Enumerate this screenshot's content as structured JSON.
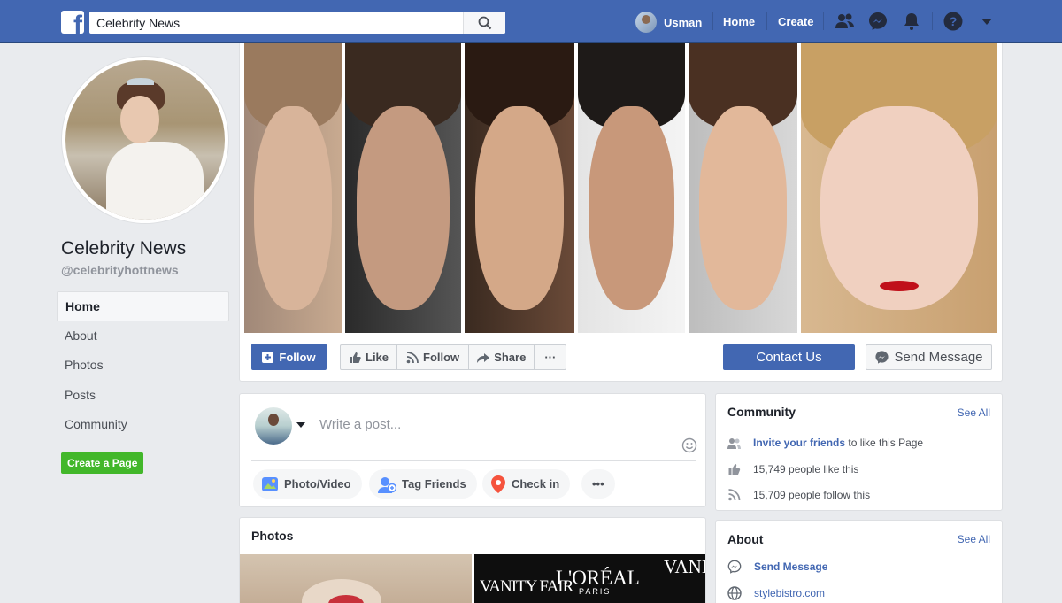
{
  "topbar": {
    "logo_letter": "f",
    "search_value": "Celebrity News",
    "user_name": "Usman",
    "nav": [
      "Home",
      "Create"
    ]
  },
  "profile": {
    "page_name": "Celebrity News",
    "handle": "@celebrityhottnews"
  },
  "left_nav": [
    {
      "label": "Home",
      "active": true
    },
    {
      "label": "About"
    },
    {
      "label": "Photos"
    },
    {
      "label": "Posts"
    },
    {
      "label": "Community"
    }
  ],
  "create_page": "Create a Page",
  "actions": {
    "follow_primary": "Follow",
    "like": "Like",
    "follow": "Follow",
    "share": "Share",
    "more": "···",
    "contact": "Contact Us",
    "send_message": "Send Message"
  },
  "composer": {
    "placeholder": "Write a post...",
    "photo_video": "Photo/Video",
    "tag_friends": "Tag Friends",
    "check_in": "Check in",
    "more": "•••"
  },
  "community": {
    "title": "Community",
    "see_all": "See All",
    "invite_link": "Invite your friends",
    "invite_rest": "to like this Page",
    "likes": "15,749 people like this",
    "follows": "15,709 people follow this"
  },
  "photos": {
    "title": "Photos",
    "photo2_caption_1": "VANITY FAIR",
    "photo2_caption_2": "L'ORÉAL",
    "photo2_caption_3": "PARIS",
    "photo2_caption_4": "VANIT"
  },
  "about": {
    "title": "About",
    "see_all": "See All",
    "send_message": "Send Message",
    "website": "stylebistro.com"
  },
  "colors": {
    "brand": "#4267b2",
    "create_green": "#42b72a"
  }
}
